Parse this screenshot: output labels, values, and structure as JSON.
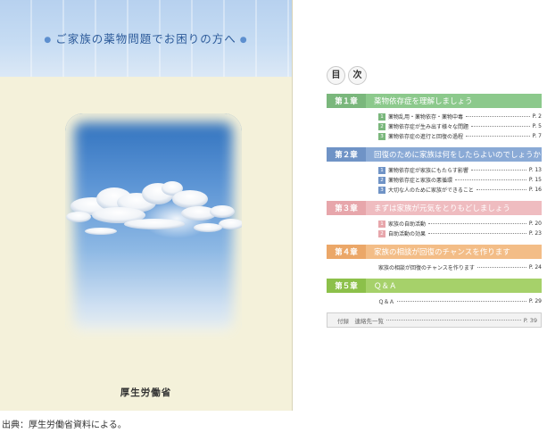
{
  "cover": {
    "title": "ご家族の薬物問題でお困りの方へ",
    "ministry": "厚生労働省",
    "colors": {
      "sky_top": "#2d6fbc",
      "band": "#b7d1ef",
      "background": "#f4f1da"
    }
  },
  "toc": {
    "heading_chars": [
      "目",
      "次"
    ],
    "chapters": [
      {
        "num": "第１章",
        "title": "薬物依存症を理解しましょう",
        "color": "#7ab77c",
        "light": "#8cc98c",
        "items": [
          {
            "n": "1",
            "label": "薬物乱用・薬物依存・薬物中毒",
            "page": "P. 2"
          },
          {
            "n": "2",
            "label": "薬物依存症が生み出す様々な問題",
            "page": "P. 5"
          },
          {
            "n": "3",
            "label": "薬物依存症の進行と回復の過程",
            "page": "P. 7"
          }
        ]
      },
      {
        "num": "第２章",
        "title": "回復のために家族は何をしたらよいのでしょうか",
        "color": "#6f93c6",
        "light": "#8aaad6",
        "items": [
          {
            "n": "1",
            "label": "薬物依存症が家族にもたらす影響",
            "page": "P. 13"
          },
          {
            "n": "2",
            "label": "薬物依存症と家族の悪循環",
            "page": "P. 15"
          },
          {
            "n": "3",
            "label": "大切な人のために家族ができること",
            "page": "P. 16"
          }
        ]
      },
      {
        "num": "第３章",
        "title": "まずは家族が元気をとりもどしましょう",
        "color": "#e7a6ab",
        "light": "#efbcc0",
        "items": [
          {
            "n": "1",
            "label": "家族の自助活動",
            "page": "P. 20"
          },
          {
            "n": "2",
            "label": "自助活動の効果",
            "page": "P. 23"
          }
        ]
      },
      {
        "num": "第４章",
        "title": "家族の相談が回復のチャンスを作ります",
        "color": "#eba768",
        "light": "#f3bd87",
        "items": [
          {
            "n": "",
            "label": "家族の相談が回復のチャンスを作ります",
            "page": "P. 24"
          }
        ]
      },
      {
        "num": "第５章",
        "title": "Ｑ＆Ａ",
        "color": "#8cc04a",
        "light": "#a6d16a",
        "items": [
          {
            "n": "",
            "label": "Ｑ＆Ａ",
            "page": "P. 29"
          }
        ]
      }
    ],
    "appendix": {
      "label": "付録　連絡先一覧",
      "page": "P. 39"
    }
  },
  "source_note": "出典：厚生労働省資料による。"
}
